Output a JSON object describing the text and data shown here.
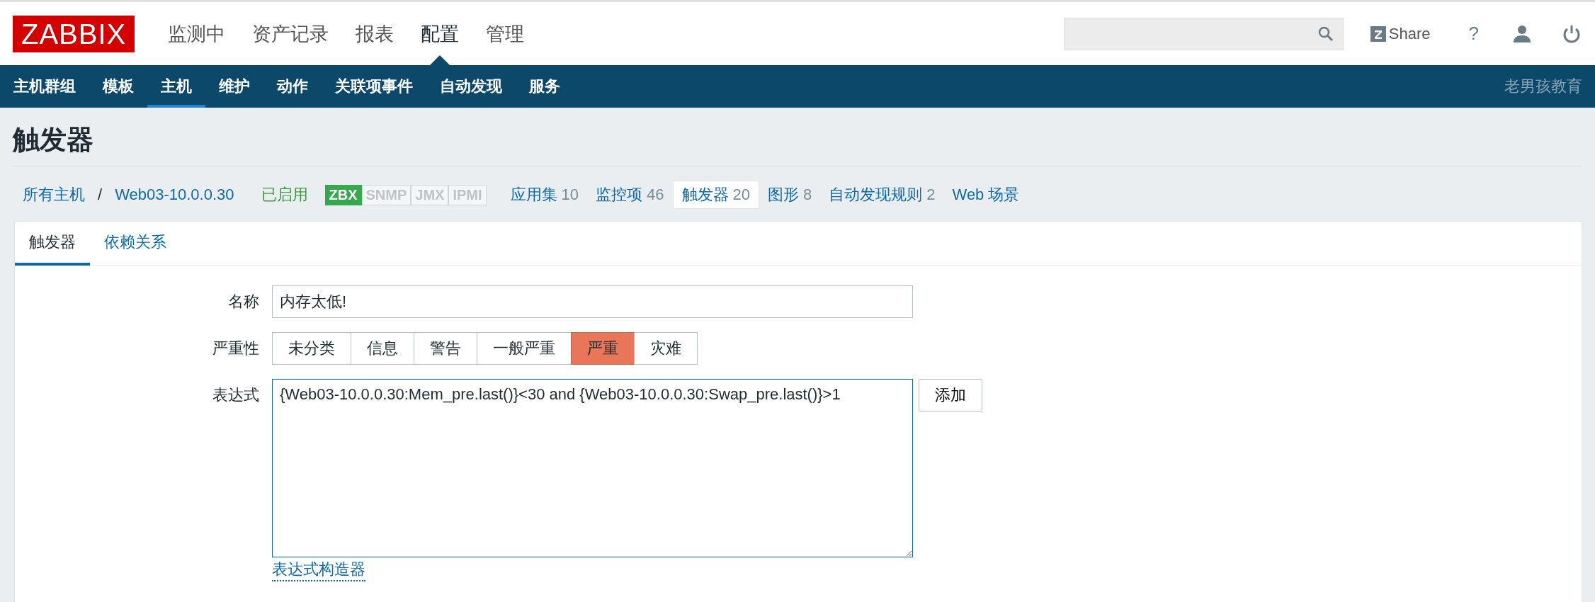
{
  "header": {
    "logo": "ZABBIX",
    "menu": [
      {
        "label": "监测中",
        "selected": false
      },
      {
        "label": "资产记录",
        "selected": false
      },
      {
        "label": "报表",
        "selected": false
      },
      {
        "label": "配置",
        "selected": true
      },
      {
        "label": "管理",
        "selected": false
      }
    ],
    "share": "Share",
    "help": "?"
  },
  "submenu": {
    "items": [
      {
        "label": "主机群组",
        "selected": false
      },
      {
        "label": "模板",
        "selected": false
      },
      {
        "label": "主机",
        "selected": true
      },
      {
        "label": "维护",
        "selected": false
      },
      {
        "label": "动作",
        "selected": false
      },
      {
        "label": "关联项事件",
        "selected": false
      },
      {
        "label": "自动发现",
        "selected": false
      },
      {
        "label": "服务",
        "selected": false
      }
    ],
    "user": "老男孩教育"
  },
  "page_title": "触发器",
  "breadcrumb": {
    "root": "所有主机",
    "separator": "/",
    "host": "Web03-10.0.0.30",
    "status": "已启用",
    "interfaces": [
      {
        "label": "ZBX",
        "available": true
      },
      {
        "label": "SNMP",
        "available": false
      },
      {
        "label": "JMX",
        "available": false
      },
      {
        "label": "IPMI",
        "available": false
      }
    ],
    "links": [
      {
        "label": "应用集",
        "count": "10",
        "selected": false
      },
      {
        "label": "监控项",
        "count": "46",
        "selected": false
      },
      {
        "label": "触发器",
        "count": "20",
        "selected": true
      },
      {
        "label": "图形",
        "count": "8",
        "selected": false
      },
      {
        "label": "自动发现规则",
        "count": "2",
        "selected": false
      },
      {
        "label": "Web 场景",
        "selected": false
      }
    ]
  },
  "tabs": [
    {
      "label": "触发器",
      "selected": true
    },
    {
      "label": "依赖关系",
      "selected": false
    }
  ],
  "form": {
    "name": {
      "label": "名称",
      "value": "内存太低!"
    },
    "severity": {
      "label": "严重性",
      "options": [
        {
          "label": "未分类",
          "selected": false
        },
        {
          "label": "信息",
          "selected": false
        },
        {
          "label": "警告",
          "selected": false
        },
        {
          "label": "一般严重",
          "selected": false
        },
        {
          "label": "严重",
          "selected": true,
          "color": "#e97659"
        },
        {
          "label": "灾难",
          "selected": false
        }
      ]
    },
    "expression": {
      "label": "表达式",
      "value": "{Web03-10.0.0.30:Mem_pre.last()}<30 and {Web03-10.0.0.30:Swap_pre.last()}>1",
      "add_button": "添加",
      "builder_link": "表达式构造器"
    }
  }
}
